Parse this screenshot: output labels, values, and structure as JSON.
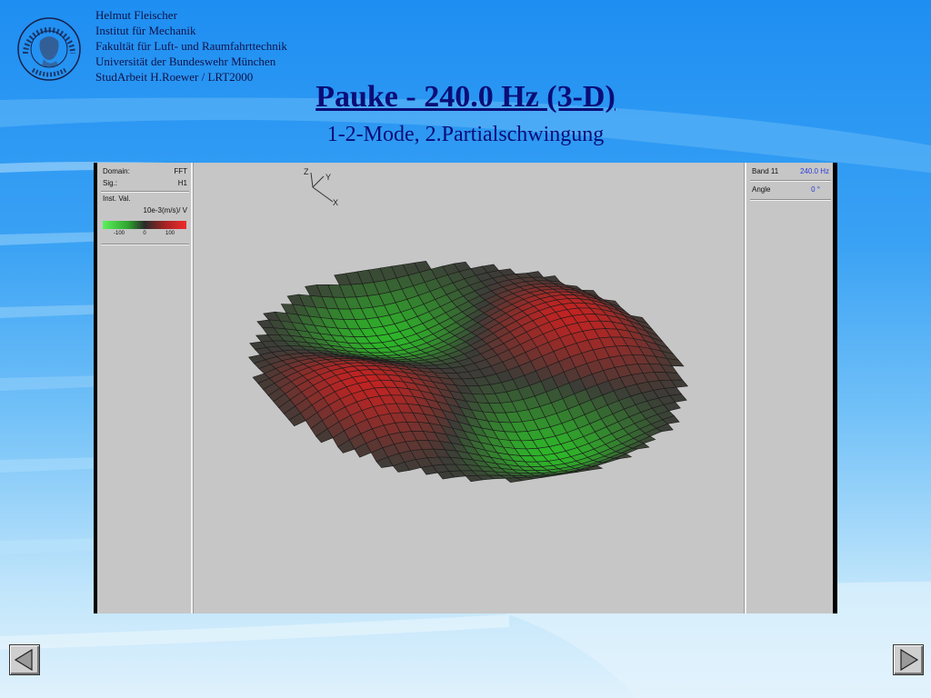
{
  "header": {
    "author": "Helmut Fleischer",
    "institute": "Institut für Mechanik",
    "faculty": "Fakultät für Luft- und Raumfahrttechnik",
    "university": "Universität der Bundeswehr München",
    "project": "StudArbeit H.Roewer / LRT2000"
  },
  "logo": {
    "ring_text": "UNIVERSITÄT DER BUNDESWEHR MÜNCHEN",
    "icon": "university-seal-icon"
  },
  "slide": {
    "title": "Pauke - 240.0 Hz (3-D)",
    "subtitle": "1-2-Mode, 2.Partialschwingung"
  },
  "left_panel": {
    "domain_label": "Domain:",
    "domain_value": "FFT",
    "sig_label": "Sig.:",
    "sig_value": "H1",
    "inst_label": "Inst. Val.",
    "unit": "10e-3(m/s)/ V",
    "ticks": [
      "-100",
      "0",
      "100"
    ]
  },
  "right_panel": {
    "band_label": "Band 11",
    "band_value": "240.0 Hz",
    "angle_label": "Angle",
    "angle_value": "0 °"
  },
  "axes": {
    "z": "Z",
    "y": "Y",
    "x": "X"
  },
  "nav": {
    "prev_icon": "triangle-left-icon",
    "next_icon": "triangle-right-icon"
  },
  "colors": {
    "title": "#0b0d76",
    "band_value": "#2a3bd6",
    "mode_positive": "#e01c1c",
    "mode_negative": "#19e019"
  }
}
